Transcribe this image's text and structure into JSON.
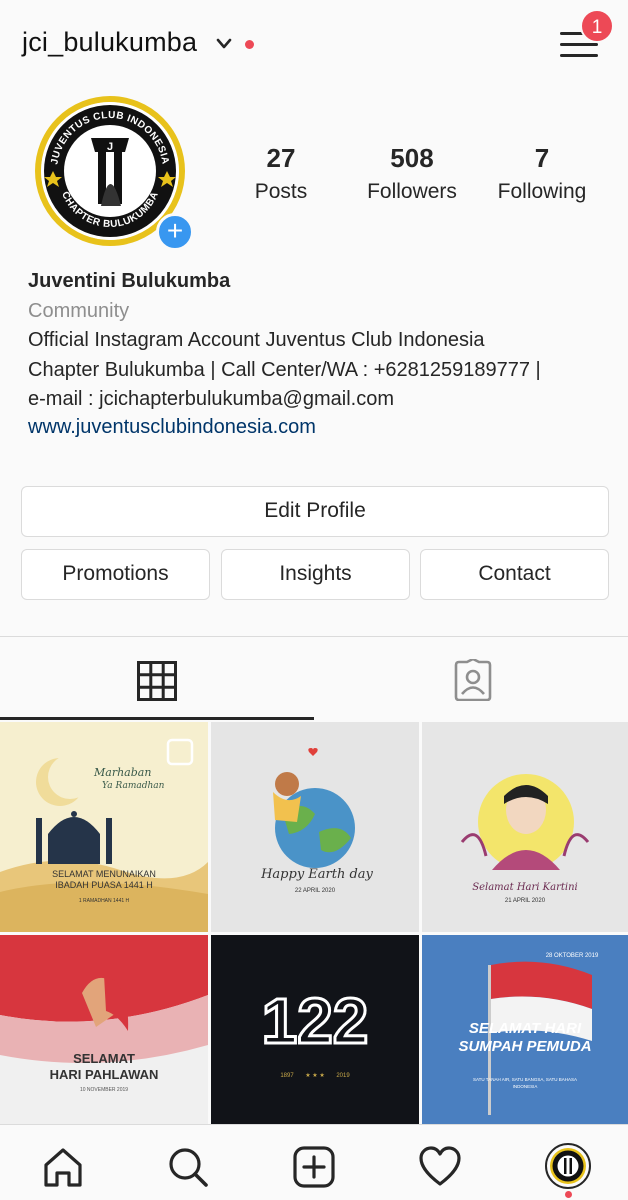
{
  "header": {
    "username": "jci_bulukumba",
    "notification_count": "1"
  },
  "profile": {
    "logo_top_text": "JUVENTUS CLUB INDONESIA",
    "logo_bottom_text": "CHAPTER BULUKUMBA",
    "stats": [
      {
        "value": "27",
        "label": "Posts"
      },
      {
        "value": "508",
        "label": "Followers"
      },
      {
        "value": "7",
        "label": "Following"
      }
    ],
    "name": "Juventini Bulukumba",
    "category": "Community",
    "bio": "Official Instagram Account Juventus Club Indonesia\nChapter Bulukumba | Call Center/WA : +6281259189777 |\ne-mail : jcichapterbulukumba@gmail.com",
    "website": "www.juventusclubindonesia.com"
  },
  "actions": {
    "edit_profile": "Edit Profile",
    "promotions": "Promotions",
    "insights": "Insights",
    "contact": "Contact"
  },
  "tabs": [
    {
      "icon": "grid-icon",
      "active": true
    },
    {
      "icon": "tagged-icon",
      "active": false
    }
  ],
  "posts": [
    {
      "id": "ramadhan",
      "lines": [
        "Marhaban",
        "Ya Ramadhan",
        "SELAMAT MENUNAIKAN",
        "IBADAH PUASA 1441 H",
        "1 RAMADHAN 1441 H"
      ]
    },
    {
      "id": "earthday",
      "lines": [
        "Happy Earth day",
        "22 APRIL 2020"
      ]
    },
    {
      "id": "kartini",
      "lines": [
        "Selamat Hari Kartini",
        "21 APRIL 2020"
      ]
    },
    {
      "id": "pahlawan",
      "lines": [
        "SELAMAT",
        "HARI PAHLAWAN",
        "10 NOVEMBER 2019"
      ]
    },
    {
      "id": "anniv",
      "lines": [
        "122",
        "1897",
        "2019"
      ]
    },
    {
      "id": "sumpah",
      "lines": [
        "28 OKTOBER 2019",
        "SELAMAT HARI",
        "SUMPAH PEMUDA",
        "SATU TANAH AIR, SATU BANGSA, SATU BAHASA",
        "INDONESIA"
      ]
    }
  ],
  "bottom_nav": [
    "home-icon",
    "search-icon",
    "new-post-icon",
    "activity-icon",
    "profile-avatar-icon"
  ],
  "colors": {
    "accent": "#3897f0",
    "alert": "#ed4956",
    "link": "#003569",
    "gold": "#e8c21b"
  }
}
